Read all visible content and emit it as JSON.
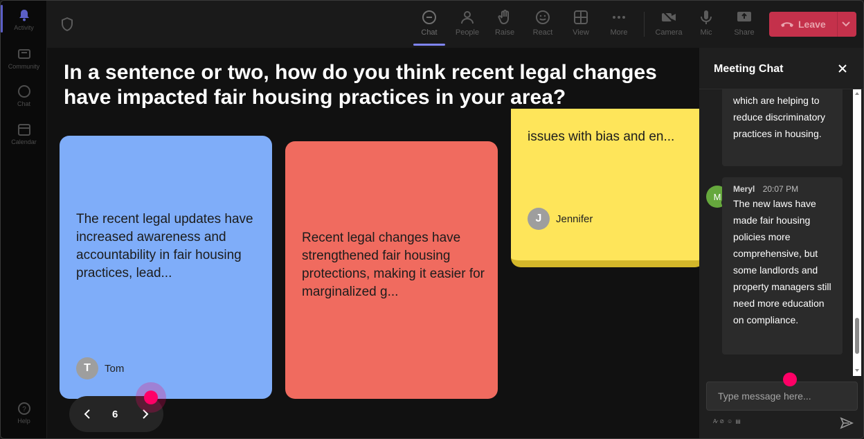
{
  "rail": {
    "items": [
      {
        "label": "Activity",
        "icon": "bell-icon"
      },
      {
        "label": "Community",
        "icon": "community-icon"
      },
      {
        "label": "Chat",
        "icon": "chat-icon"
      },
      {
        "label": "Calendar",
        "icon": "calendar-icon"
      }
    ],
    "help": {
      "label": "Help",
      "icon": "help-icon"
    }
  },
  "toolbar": {
    "chat": "Chat",
    "people": "People",
    "raise": "Raise",
    "react": "React",
    "view": "View",
    "more": "More",
    "camera": "Camera",
    "mic": "Mic",
    "share": "Share",
    "leave": "Leave"
  },
  "stage": {
    "question": "In a sentence or two, how do you think recent legal changes have impacted fair housing practices in your area?",
    "cards": [
      {
        "text": "The recent legal updates have increased awareness and accountability in fair housing practices, lead...",
        "author": "Tom",
        "initial": "T",
        "color": "#7fadf9"
      },
      {
        "text": "Recent legal changes have strengthened fair housing protections, making it easier for marginalized g...",
        "author": "",
        "initial": "",
        "color": "#f06b5f"
      },
      {
        "text": "issues with bias and en...",
        "author": "Jennifer",
        "initial": "J",
        "color": "#fee55a"
      }
    ],
    "page": "6"
  },
  "chat": {
    "title": "Meeting Chat",
    "messages": [
      {
        "text": "which are helping to reduce discriminatory practices in housing."
      },
      {
        "name": "Meryl",
        "time": "20:07 PM",
        "initial": "M",
        "text": "The new laws have made fair housing policies more comprehensive, but some landlords and property managers still need more education on compliance."
      }
    ],
    "input_placeholder": "Type message here...",
    "accent": "#ff0066"
  }
}
